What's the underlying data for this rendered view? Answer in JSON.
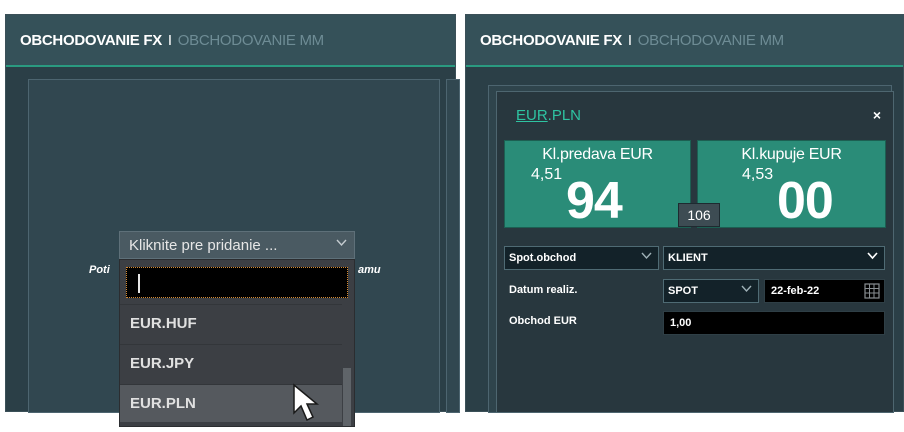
{
  "left_panel": {
    "header": {
      "tab_active": "OBCHODOVANIE FX",
      "separator": "I",
      "tab_inactive": "OBCHODOVANIE MM"
    },
    "add_button": {
      "label": "Kliknite pre pridanie ..."
    },
    "background_text_left": "Poti",
    "background_text_right": "amu",
    "dropdown": {
      "input_value": "",
      "items": [
        "EUR.HUF",
        "EUR.JPY",
        "EUR.PLN"
      ],
      "selected": "EUR.PLN"
    }
  },
  "right_panel": {
    "header": {
      "tab_active": "OBCHODOVANIE FX",
      "separator": "I",
      "tab_inactive": "OBCHODOVANIE MM"
    },
    "widget": {
      "pair_base": "EUR",
      "pair_quote": ".PLN",
      "close": "×",
      "sell": {
        "label": "Kl.predava EUR",
        "small": "4,51",
        "big": "94"
      },
      "buy": {
        "label": "Kl.kupuje EUR",
        "small": "4,53",
        "big": "00"
      },
      "spread": "106",
      "trade_type": "Spot.obchod",
      "client": "KLIENT",
      "settlement_label": "Datum realiz.",
      "settlement_type": "SPOT",
      "settlement_date": "22-feb-22",
      "amount_label": "Obchod EUR",
      "amount_value": "1,00"
    }
  },
  "colors": {
    "accent": "#2a8c78",
    "pair": "#2ec4a2",
    "panel_bg": "#2b3f47"
  }
}
